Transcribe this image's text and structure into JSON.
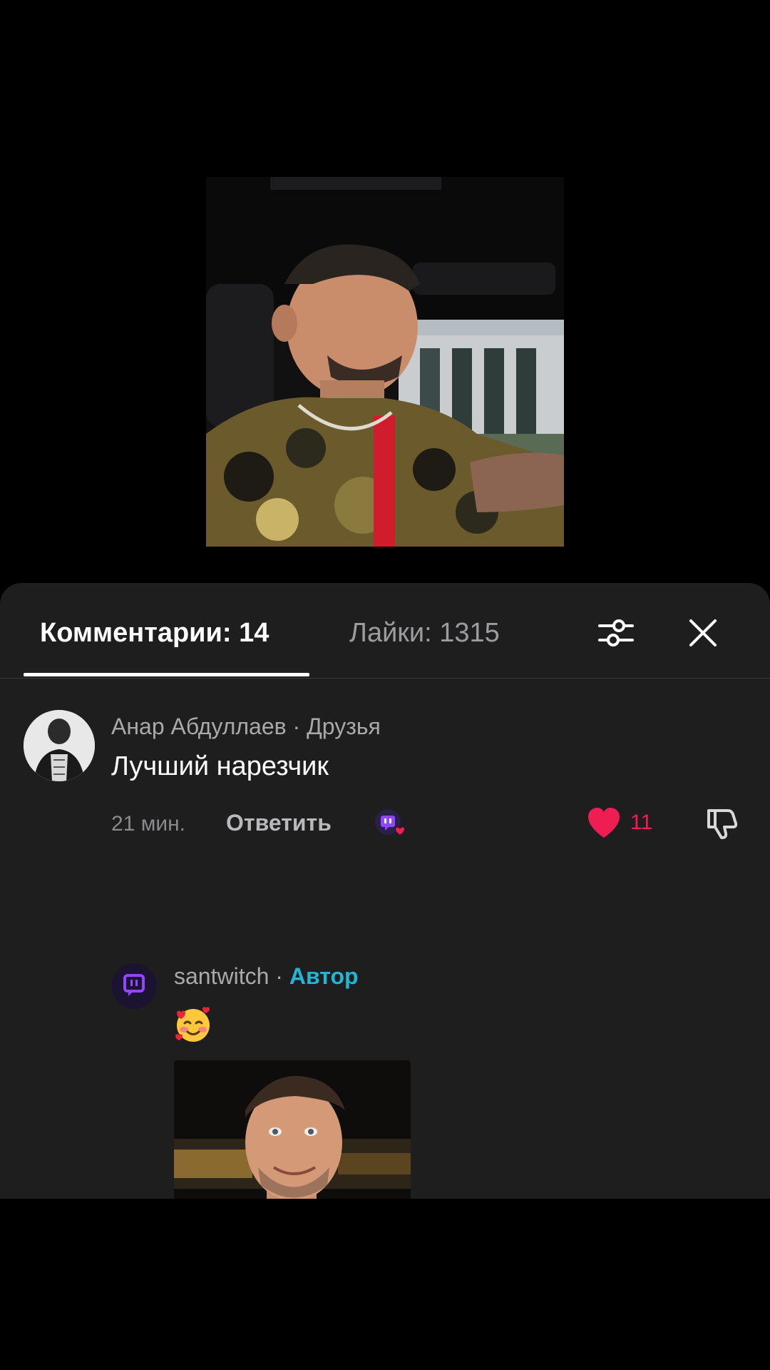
{
  "tabs": {
    "comments_label": "Комментарии: 14",
    "likes_label": "Лайки: 1315"
  },
  "comment": {
    "author": "Анар Абдуллаев · Друзья",
    "text": "Лучший нарезчик",
    "time": "21 мин.",
    "reply_label": "Ответить",
    "like_count": "11",
    "liked": true
  },
  "reply": {
    "username": "santwitch",
    "separator": " · ",
    "badge": "Автор",
    "emoji": "smiling-face-with-hearts",
    "has_photo": true
  },
  "colors": {
    "sheet_bg": "#1e1e1f",
    "like_red": "#ee1d52",
    "author_badge": "#20b6d4",
    "twitch_purple": "#9146ff"
  },
  "icons": [
    "sliders-icon",
    "close-icon",
    "heart-icon",
    "dislike-icon",
    "creator-like-icon",
    "twitch-icon"
  ]
}
